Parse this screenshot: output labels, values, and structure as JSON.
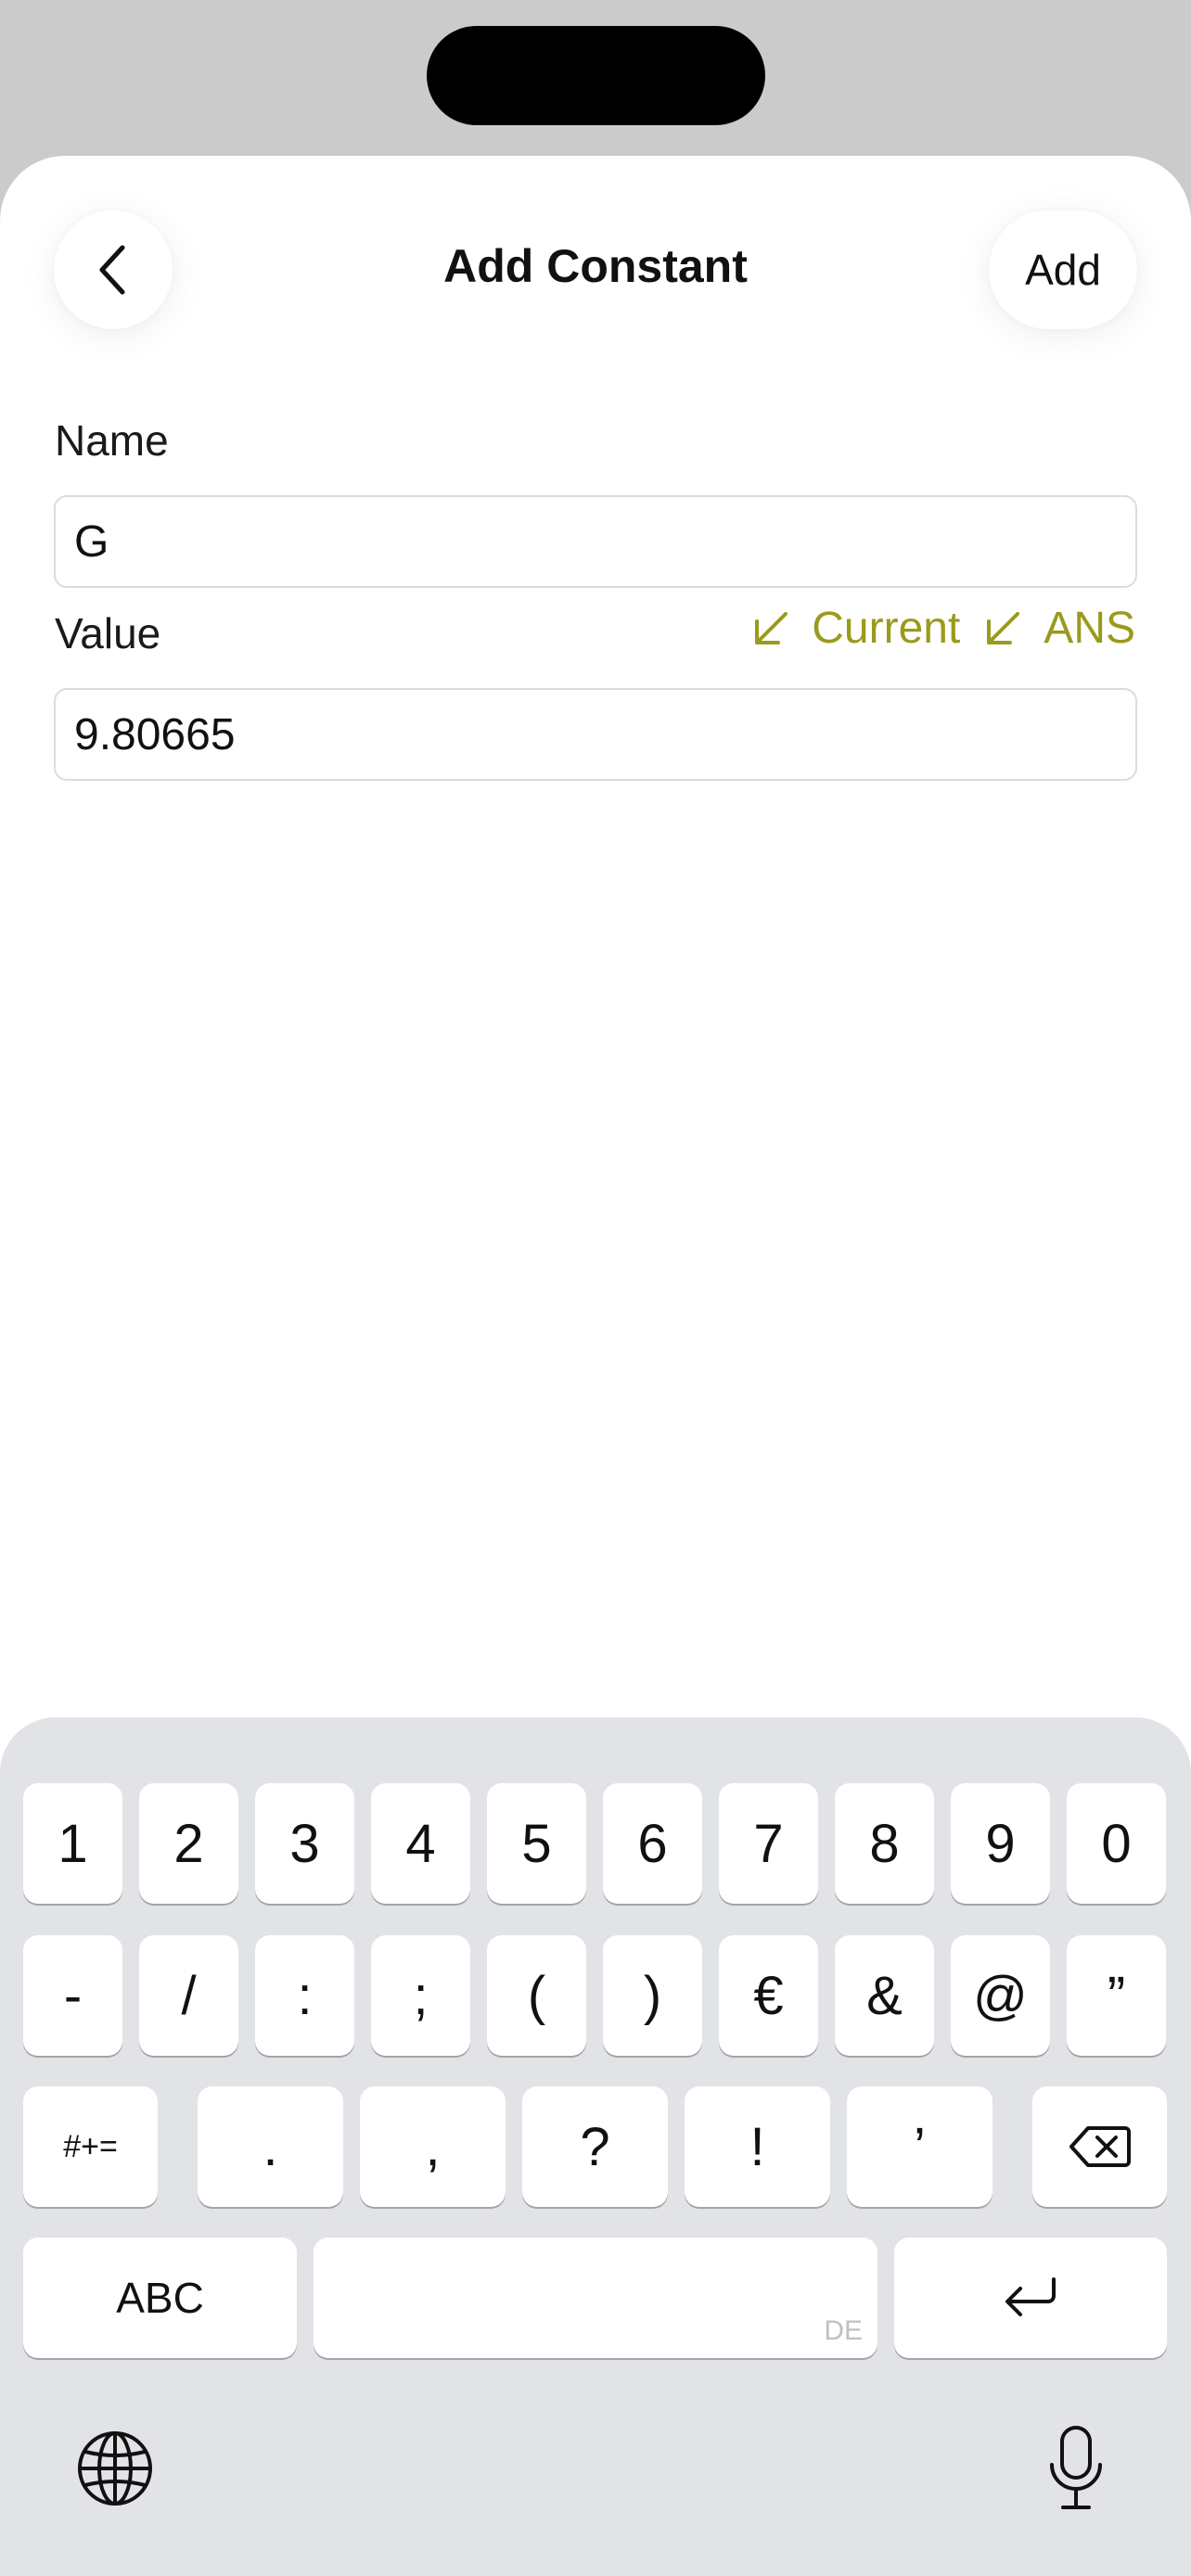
{
  "header": {
    "title": "Add Constant",
    "add_label": "Add"
  },
  "form": {
    "name_label": "Name",
    "name_value": "G",
    "value_label": "Value",
    "value_value": "9.80665",
    "current_label": "Current",
    "ans_label": "ANS"
  },
  "colors": {
    "accent": "#9a9a1c",
    "keyboard_bg": "#e2e3e7",
    "status_bg": "#cbcbcb"
  },
  "keyboard": {
    "row1": [
      "1",
      "2",
      "3",
      "4",
      "5",
      "6",
      "7",
      "8",
      "9",
      "0"
    ],
    "row2": [
      "-",
      "/",
      ":",
      ";",
      "(",
      ")",
      "€",
      "&",
      "@",
      "”"
    ],
    "row3_mode": "#+=",
    "row3": [
      ".",
      ",",
      "?",
      "!",
      "’"
    ],
    "abc_label": "ABC",
    "space_lang": "DE"
  },
  "icons": {
    "back": "chevron-left-icon",
    "current": "arrow-down-left-icon",
    "ans": "arrow-down-left-icon",
    "delete": "delete-backspace-icon",
    "return": "return-icon",
    "globe": "globe-icon",
    "mic": "microphone-icon"
  }
}
